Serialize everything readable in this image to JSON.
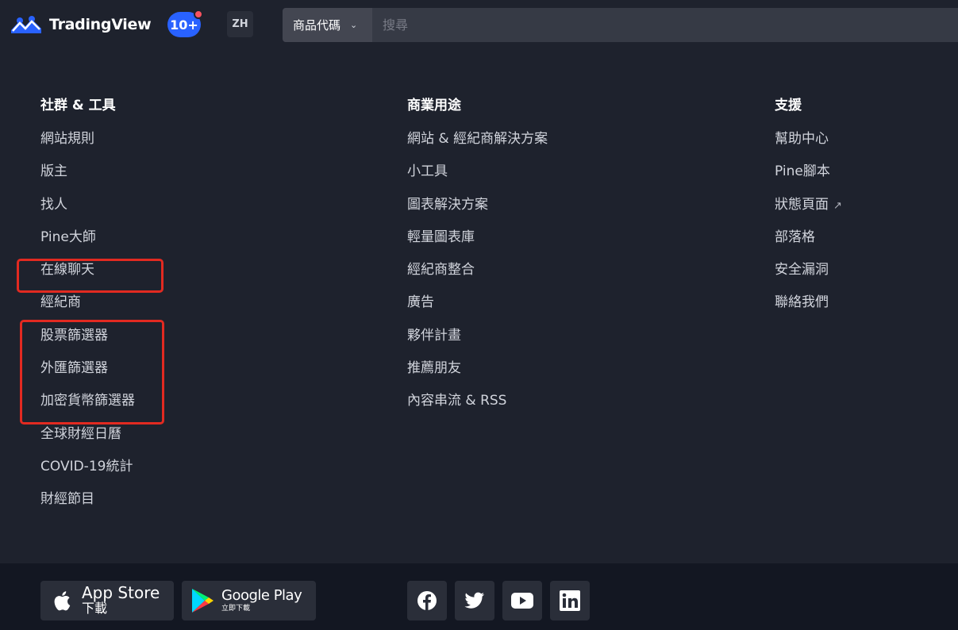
{
  "header": {
    "logo_text": "TradingView",
    "notification_count": "10+",
    "language": "ZH",
    "search_type": "商品代碼",
    "search_placeholder": "搜尋"
  },
  "columns": {
    "community": {
      "title": "社群 & 工具",
      "items": [
        "網站規則",
        "版主",
        "找人",
        "Pine大師",
        "在線聊天",
        "經紀商",
        "股票篩選器",
        "外匯篩選器",
        "加密貨幣篩選器",
        "全球財經日曆",
        "COVID-19統計",
        "財經節目"
      ]
    },
    "business": {
      "title": "商業用途",
      "items": [
        "網站 & 經紀商解決方案",
        "小工具",
        "圖表解決方案",
        "輕量圖表庫",
        "經紀商整合",
        "廣告",
        "夥伴計畫",
        "推薦朋友",
        "內容串流 & RSS"
      ]
    },
    "support": {
      "title": "支援",
      "items": [
        "幫助中心",
        "Pine腳本",
        "狀態頁面",
        "部落格",
        "安全漏洞",
        "聯絡我們"
      ]
    }
  },
  "footer": {
    "app_store": {
      "title": "App Store",
      "subtitle": "下載"
    },
    "google_play": {
      "title": "Google Play",
      "subtitle": "立即下載"
    },
    "social_icons": [
      "facebook-icon",
      "twitter-icon",
      "youtube-icon",
      "linkedin-icon"
    ]
  },
  "colors": {
    "background": "#1e222d",
    "footer": "#131722",
    "accent": "#2962ff",
    "highlight": "#e22a21"
  }
}
